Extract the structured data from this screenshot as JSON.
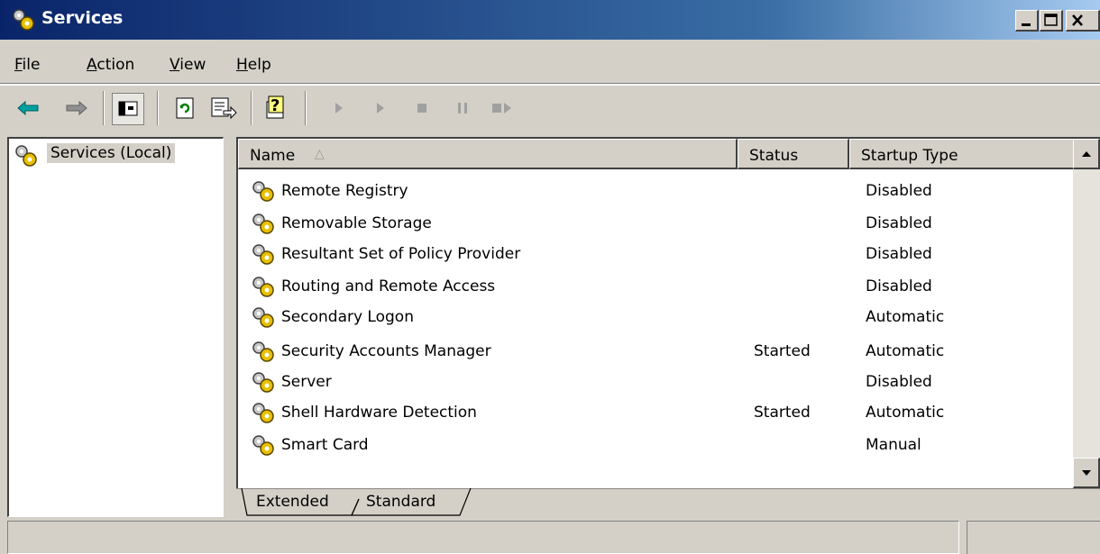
{
  "window": {
    "title": "Services"
  },
  "menu": {
    "items": [
      {
        "label": "File",
        "accel": "F"
      },
      {
        "label": "Action",
        "accel": "A"
      },
      {
        "label": "View",
        "accel": "V"
      },
      {
        "label": "Help",
        "accel": "H"
      }
    ]
  },
  "toolbar": {
    "buttons": [
      "back-icon",
      "forward-icon",
      "show-hide-console-tree-icon",
      "refresh-icon",
      "export-list-icon",
      "help-icon",
      "start-service-icon",
      "start-service-params-icon",
      "stop-service-icon",
      "pause-service-icon",
      "restart-service-icon"
    ]
  },
  "tree": {
    "root_label": "Services (Local)"
  },
  "list": {
    "columns": [
      "Name",
      "Status",
      "Startup Type"
    ],
    "sort_indicator": "△",
    "rows": [
      {
        "name": "Remote Registry",
        "status": "",
        "startup": "Disabled"
      },
      {
        "name": "Removable Storage",
        "status": "",
        "startup": "Disabled"
      },
      {
        "name": "Resultant Set of Policy Provider",
        "status": "",
        "startup": "Disabled"
      },
      {
        "name": "Routing and Remote Access",
        "status": "",
        "startup": "Disabled"
      },
      {
        "name": "Secondary Logon",
        "status": "",
        "startup": "Automatic"
      },
      {
        "name": "Security Accounts Manager",
        "status": "Started",
        "startup": "Automatic"
      },
      {
        "name": "Server",
        "status": "",
        "startup": "Disabled"
      },
      {
        "name": "Shell Hardware Detection",
        "status": "Started",
        "startup": "Automatic"
      },
      {
        "name": "Smart Card",
        "status": "",
        "startup": "Manual"
      }
    ]
  },
  "tabs": {
    "items": [
      "Extended",
      "Standard"
    ],
    "selected": "Standard"
  },
  "colors": {
    "title_active_start": "#0a246a",
    "title_active_end": "#a6caf0",
    "face": "#d4d0c8"
  }
}
